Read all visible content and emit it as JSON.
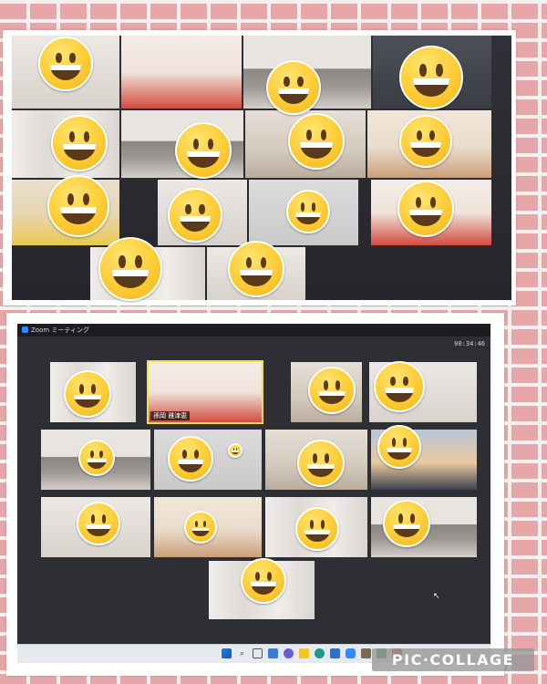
{
  "collage": {
    "watermark": "PIC·COLLAGE",
    "colors": {
      "background_grid": "#e7a6a8",
      "grid_lines": "#f3f0f0",
      "frame": "#ffffff"
    }
  },
  "zoom_window": {
    "title": "Zoom ミーティング",
    "timer": "00:34:46",
    "active_speaker_name": "孫岡 雅津恵",
    "accent_color": "#2d8cff"
  },
  "taskbar": {
    "icons": [
      "windows-start-icon",
      "search-icon",
      "task-view-icon",
      "widgets-icon",
      "chat-icon",
      "file-explorer-icon",
      "edge-icon",
      "store-icon",
      "zoom-icon",
      "app-icon",
      "app-icon",
      "app-icon"
    ]
  },
  "emoji": {
    "name": "grinning-face-emoji",
    "color": "#fccc34"
  }
}
